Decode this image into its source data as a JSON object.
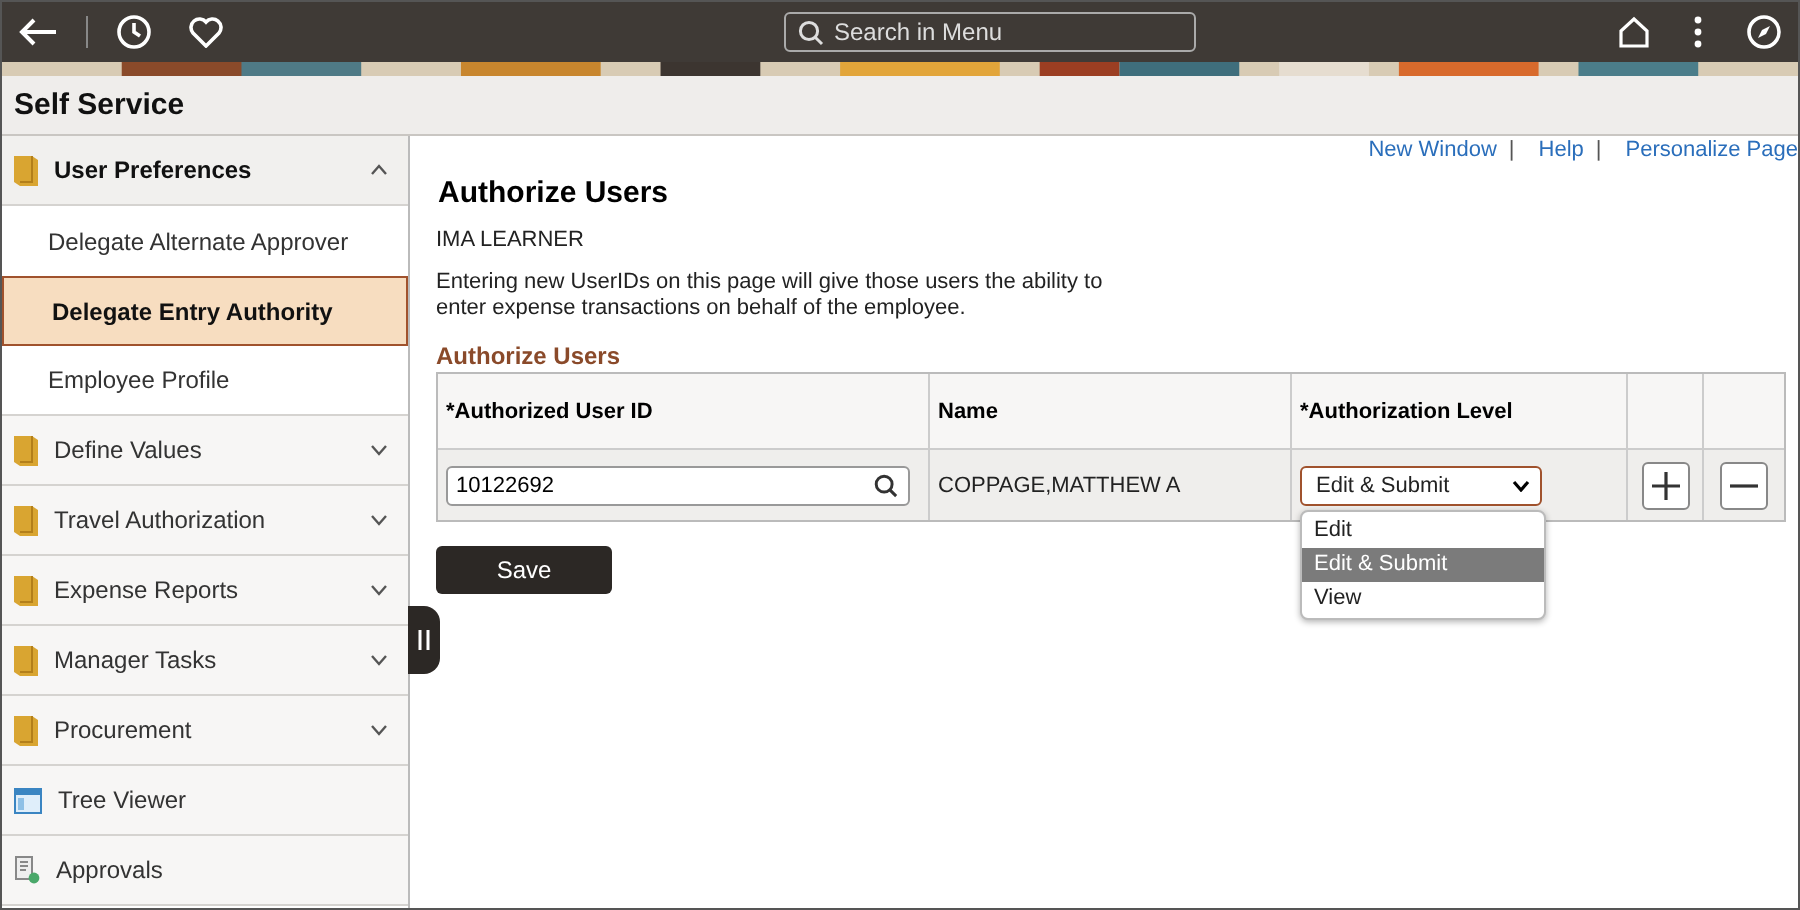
{
  "top_bar": {
    "search": {
      "placeholder": "Search in Menu"
    }
  },
  "title_bar": {
    "title": "Self Service"
  },
  "sidebar": {
    "items": [
      {
        "kind": "folder",
        "label": "User Preferences",
        "expanded": true,
        "children": [
          {
            "label": "Delegate Alternate Approver",
            "selected": false
          },
          {
            "label": "Delegate Entry Authority",
            "selected": true
          },
          {
            "label": "Employee Profile",
            "selected": false
          }
        ]
      },
      {
        "kind": "folder",
        "label": "Define Values",
        "expanded": false
      },
      {
        "kind": "folder",
        "label": "Travel Authorization",
        "expanded": false
      },
      {
        "kind": "folder",
        "label": "Expense Reports",
        "expanded": false
      },
      {
        "kind": "folder",
        "label": "Manager Tasks",
        "expanded": false
      },
      {
        "kind": "folder",
        "label": "Procurement",
        "expanded": false
      },
      {
        "kind": "tree",
        "label": "Tree Viewer"
      },
      {
        "kind": "approvals",
        "label": "Approvals"
      }
    ]
  },
  "page_links": {
    "separator": "|",
    "items": [
      "New Window",
      "Help",
      "Personalize Page"
    ]
  },
  "page": {
    "title": "Authorize Users",
    "employee": "IMA LEARNER",
    "description": "Entering new UserIDs on this page will give those users the ability to enter expense transactions on behalf of the employee.",
    "section_title": "Authorize Users",
    "table": {
      "columns": [
        "*Authorized User ID",
        "Name",
        "*Authorization Level"
      ],
      "rows": [
        {
          "user_id": "10122692",
          "name": "COPPAGE,MATTHEW A",
          "level": {
            "value": "Edit & Submit",
            "open": true,
            "options": [
              {
                "label": "Edit",
                "selected": false
              },
              {
                "label": "Edit & Submit",
                "selected": true
              },
              {
                "label": "View",
                "selected": false
              }
            ]
          }
        }
      ]
    },
    "save_button": "Save"
  }
}
